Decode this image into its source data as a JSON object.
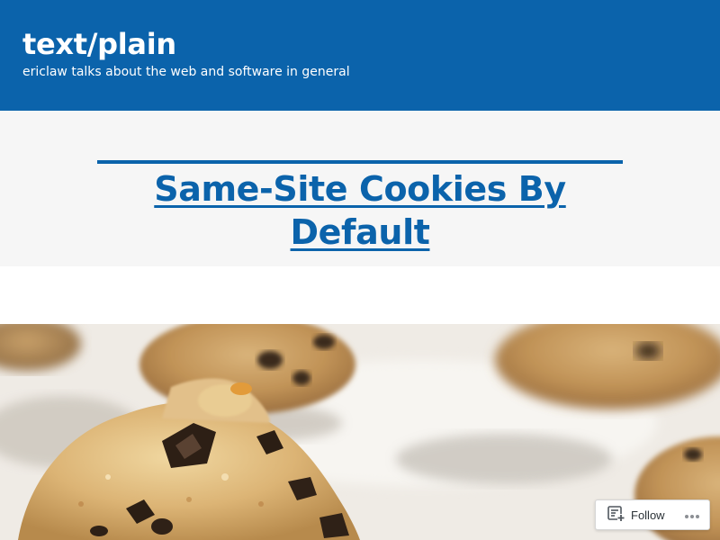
{
  "site": {
    "title": "text/plain",
    "description": "ericlaw talks about the web and software in general"
  },
  "post": {
    "title": "Same-Site Cookies By Default"
  },
  "hero_image": {
    "icon": "cookie-dough-photo"
  },
  "follow_widget": {
    "label": "Follow",
    "icon": "reader-follow-icon",
    "more_icon": "ellipsis-icon"
  },
  "colors": {
    "brand": "#0b63ab",
    "title_band": "#f6f6f6",
    "header_text": "#ffffff"
  }
}
